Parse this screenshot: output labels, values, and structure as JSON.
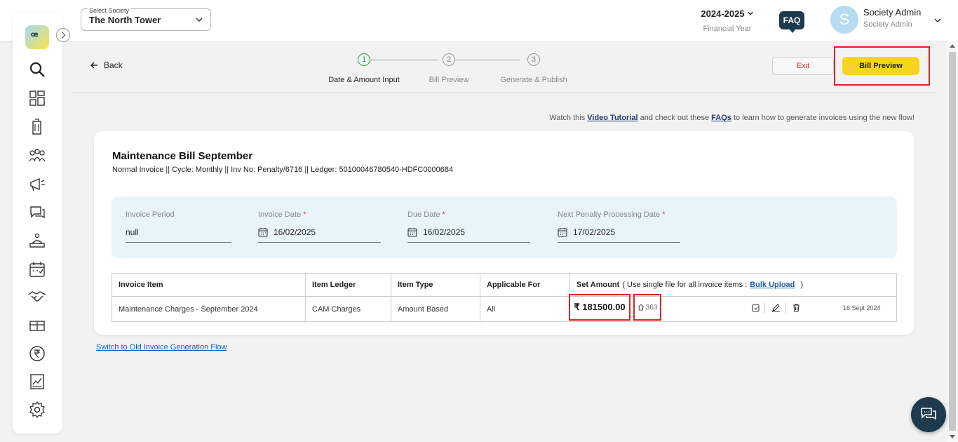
{
  "header": {
    "society_label": "Select Society",
    "society_value": "The North Tower",
    "financial_year": "2024-2025",
    "financial_year_label": "Financial Year",
    "faq_label": "FAQ",
    "avatar_letter": "S",
    "user_name": "Society Admin",
    "user_role": "Society Admin"
  },
  "sidebar": {
    "logo_text": "ꟹ",
    "icons": [
      "search-icon",
      "dashboard-icon",
      "building-icon",
      "members-icon",
      "announcement-icon",
      "chat-icon",
      "helpdesk-icon",
      "calendar-icon",
      "handshake-icon",
      "parking-icon",
      "rupee-icon",
      "report-icon",
      "settings-icon"
    ]
  },
  "subheader": {
    "back_label": "Back",
    "steps": [
      {
        "num": "1",
        "label": "Date & Amount Input"
      },
      {
        "num": "2",
        "label": "Bill Preview"
      },
      {
        "num": "3",
        "label": "Generate & Publish"
      }
    ],
    "exit_label": "Exit",
    "preview_label": "Bill Preview"
  },
  "tutorial": {
    "prefix": "Watch this ",
    "video_link": "Video Tutorial",
    "middle": " and check out these ",
    "faq_link": "FAQs",
    "suffix": " to learn how to generate invoices using the new flow!"
  },
  "bill": {
    "title": "Maintenance Bill September",
    "subtitle": "Normal Invoice || Cycle: Monthly || Inv No: Penalty/6716 || Ledger: 50100046780540-HDFC0000684",
    "fields": [
      {
        "label": "Invoice Period",
        "required": "",
        "value": "null"
      },
      {
        "label": "Invoice Date",
        "required": "*",
        "value": "16/02/2025"
      },
      {
        "label": "Due Date",
        "required": "*",
        "value": "16/02/2025"
      },
      {
        "label": "Next Penalty Processing Date",
        "required": "*",
        "value": "17/02/2025"
      }
    ]
  },
  "table": {
    "headers": {
      "item": "Invoice Item",
      "ledger": "Item Ledger",
      "type": "Item Type",
      "applicable": "Applicable For",
      "amount": "Set Amount",
      "amount_note_prefix": "( Use single file for all invoice items :",
      "bulk_upload": "Bulk Upload",
      "amount_note_suffix": ")"
    },
    "row": {
      "item": "Maintenance Charges - September 2024",
      "ledger": "CAM Charges",
      "type": "Amount Based",
      "applicable": "All",
      "amount": "₹ 181500.00",
      "units": "363",
      "date": "16 Sept 2024"
    }
  },
  "old_flow_link": "Switch to Old Invoice Generation Flow",
  "colors": {
    "accent_yellow": "#f7d51f",
    "navy": "#1d3a4f",
    "highlight_red": "#d32626",
    "active_step_green": "#22a34a"
  }
}
